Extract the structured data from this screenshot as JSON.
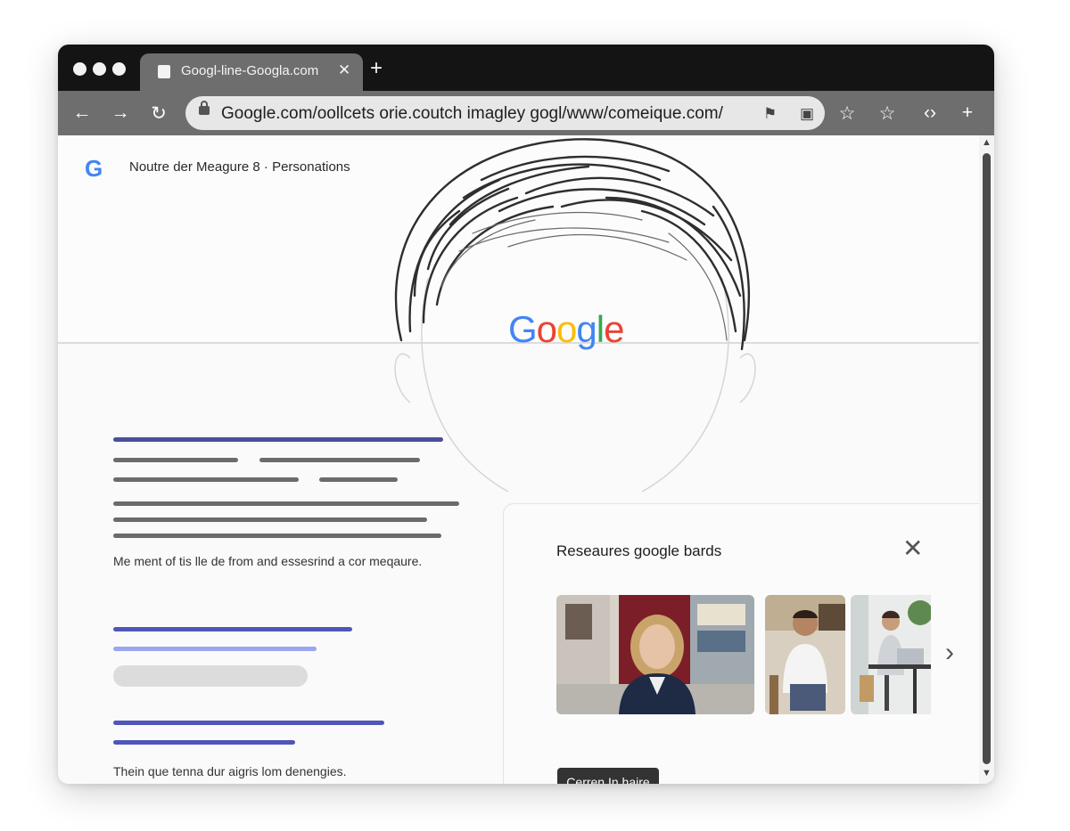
{
  "tab": {
    "title": "Googl‑line‑Googla.com",
    "close_icon": "close-icon",
    "new_tab_icon": "plus-icon"
  },
  "toolbar": {
    "url": "Google.com/oollcets orie.coutch imagley gogl/www/comeique.com/"
  },
  "page": {
    "google_mark": "G",
    "heading": "Noutre der Meagure 8 · Personations",
    "logo": [
      "G",
      "o",
      "o",
      "g",
      "l",
      "e"
    ],
    "logo_colors": [
      "#4285F4",
      "#EA4335",
      "#FBBC05",
      "#4285F4",
      "#34A853",
      "#EA4335"
    ],
    "text1": "Me ment of tis lle de from and essesrind a cor meqaure.",
    "text2": "Thein que tenna dur aigris lom denengies."
  },
  "panel": {
    "title": "Reseaures google bards",
    "button": "Cerren In haire"
  },
  "colors": {
    "accent": "#4f56b8",
    "accent_light": "#9aa6ef",
    "chrome_dark": "#141414",
    "chrome_mid": "#6e6e6e"
  }
}
